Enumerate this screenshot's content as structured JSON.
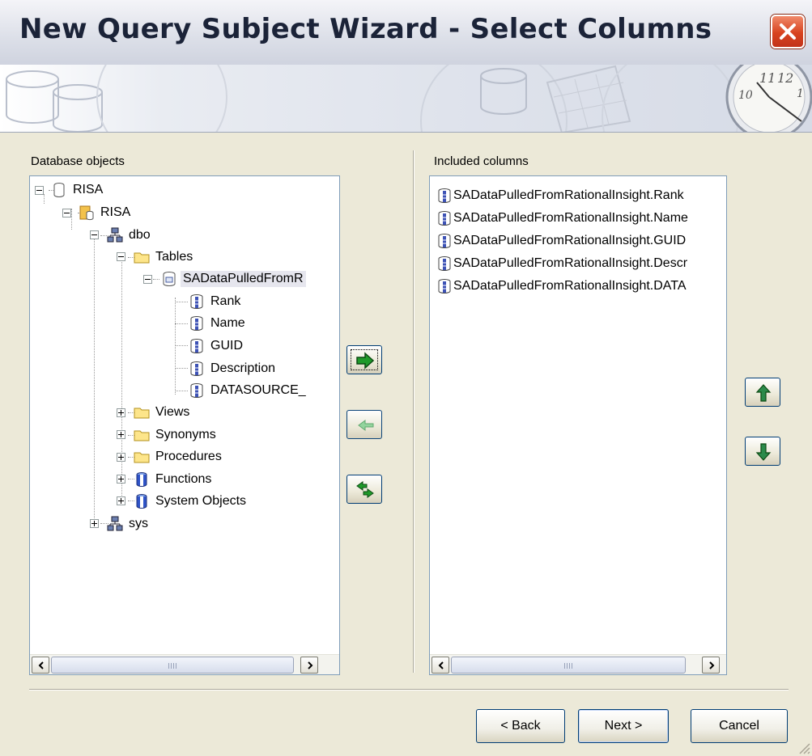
{
  "window": {
    "title": "New Query Subject Wizard - Select Columns"
  },
  "left_panel": {
    "label": "Database objects",
    "tree": [
      {
        "id": "n0",
        "label": "RISA",
        "icon": "database-icon",
        "expander": "minus"
      },
      {
        "id": "n1",
        "label": "RISA",
        "icon": "catalog-icon",
        "expander": "minus"
      },
      {
        "id": "n2",
        "label": "dbo",
        "icon": "schema-icon",
        "expander": "minus"
      },
      {
        "id": "n3",
        "label": "Tables",
        "icon": "folder-icon",
        "expander": "minus"
      },
      {
        "id": "n4",
        "label": "SADataPulledFromR",
        "icon": "table-icon",
        "expander": "minus",
        "selected": true
      },
      {
        "id": "n5",
        "label": "Rank",
        "icon": "column-icon"
      },
      {
        "id": "n6",
        "label": "Name",
        "icon": "column-icon"
      },
      {
        "id": "n7",
        "label": "GUID",
        "icon": "column-icon"
      },
      {
        "id": "n8",
        "label": "Description",
        "icon": "column-icon"
      },
      {
        "id": "n9",
        "label": "DATASOURCE_",
        "icon": "column-icon"
      },
      {
        "id": "n10",
        "label": "Views",
        "icon": "folder-icon",
        "expander": "plus"
      },
      {
        "id": "n11",
        "label": "Synonyms",
        "icon": "folder-icon",
        "expander": "plus"
      },
      {
        "id": "n12",
        "label": "Procedures",
        "icon": "folder-icon",
        "expander": "plus"
      },
      {
        "id": "n13",
        "label": "Functions",
        "icon": "stored-object-icon",
        "expander": "plus"
      },
      {
        "id": "n14",
        "label": "System Objects",
        "icon": "stored-object-icon",
        "expander": "plus"
      },
      {
        "id": "n15",
        "label": "sys",
        "icon": "schema-icon",
        "expander": "plus"
      }
    ],
    "scroll_grip_icon": "scroll-grip-icon"
  },
  "right_panel": {
    "label": "Included columns",
    "items": [
      "SADataPulledFromRationalInsight.Rank",
      "SADataPulledFromRationalInsight.Name",
      "SADataPulledFromRationalInsight.GUID",
      "SADataPulledFromRationalInsight.Descr",
      "SADataPulledFromRationalInsight.DATA"
    ]
  },
  "transfer_buttons": {
    "add": {
      "icon": "right-arrow-icon"
    },
    "remove": {
      "icon": "left-arrow-icon",
      "enabled": false
    },
    "swap": {
      "icon": "swap-arrows-icon"
    }
  },
  "order_buttons": {
    "up": {
      "icon": "up-arrow-icon"
    },
    "down": {
      "icon": "down-arrow-icon"
    }
  },
  "footer": {
    "back_label": "< Back",
    "next_label": "Next >",
    "cancel_label": "Cancel"
  },
  "colors": {
    "dialog_bg": "#ece9d8",
    "list_border": "#7f9db9",
    "arrow_green": "#1f9a2a",
    "close_red": "#d8431f",
    "title_text": "#1b2338"
  }
}
